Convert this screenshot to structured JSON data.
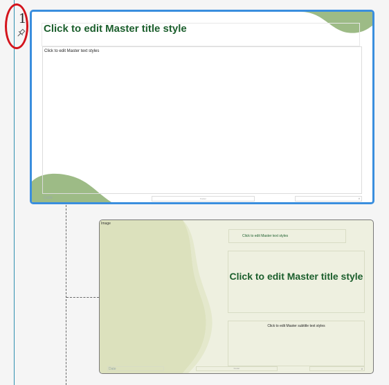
{
  "slide_panel": {
    "slide_number": "1",
    "pin_icon": "pushpin-icon"
  },
  "master_slide": {
    "title": "Click to edit Master title style",
    "body_text": "Click to edit Master text styles",
    "footer_date": "Date",
    "footer_text": "Footer",
    "page_number": "#",
    "accent_color": "#8fb27a"
  },
  "layout_slide": {
    "image_label": "Image",
    "text_label": "Click to edit Master text styles",
    "title": "Click to edit Master title style",
    "subtitle": "Click to edit Master subtitle text styles",
    "footer_date": "Date",
    "footer_text": "Footer",
    "page_number": "#",
    "background_color": "#eef0e0"
  },
  "colors": {
    "selection_border": "#3a8ede",
    "title_green": "#1b5e2c",
    "annotation_red": "#d4141c"
  }
}
